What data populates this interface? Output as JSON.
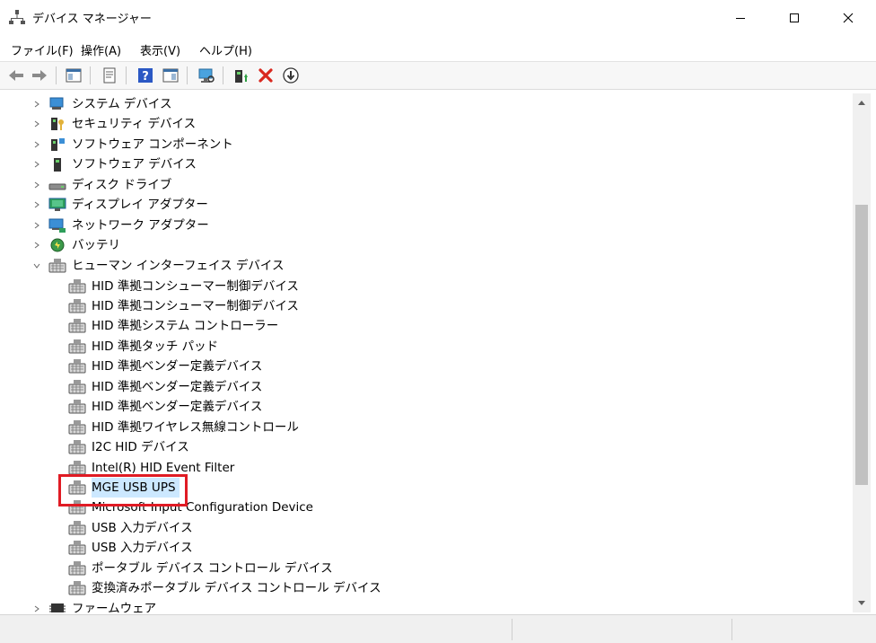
{
  "window": {
    "title": "デバイス マネージャー"
  },
  "menu": {
    "items": [
      "ファイル(F)",
      "操作(A)",
      "表示(V)",
      "ヘルプ(H)"
    ]
  },
  "tree": {
    "categories_top": [
      {
        "label": "システム デバイス",
        "icon": "system-devices-icon"
      },
      {
        "label": "セキュリティ デバイス",
        "icon": "security-devices-icon"
      },
      {
        "label": "ソフトウェア コンポーネント",
        "icon": "software-components-icon"
      },
      {
        "label": "ソフトウェア デバイス",
        "icon": "software-devices-icon"
      },
      {
        "label": "ディスク ドライブ",
        "icon": "disk-drive-icon"
      },
      {
        "label": "ディスプレイ アダプター",
        "icon": "display-adapter-icon"
      },
      {
        "label": "ネットワーク アダプター",
        "icon": "network-adapter-icon"
      },
      {
        "label": "バッテリ",
        "icon": "battery-icon"
      }
    ],
    "hid": {
      "label": "ヒューマン インターフェイス デバイス",
      "children": [
        "HID 準拠コンシューマー制御デバイス",
        "HID 準拠コンシューマー制御デバイス",
        "HID 準拠システム コントローラー",
        "HID 準拠タッチ パッド",
        "HID 準拠ベンダー定義デバイス",
        "HID 準拠ベンダー定義デバイス",
        "HID 準拠ベンダー定義デバイス",
        "HID 準拠ワイヤレス無線コントロール",
        "I2C HID デバイス",
        "Intel(R) HID Event Filter",
        "MGE USB UPS",
        "Microsoft Input Configuration Device",
        "USB 入力デバイス",
        "USB 入力デバイス",
        "ポータブル デバイス コントロール デバイス",
        "変換済みポータブル デバイス コントロール デバイス"
      ],
      "selected_index": 10
    },
    "category_bottom": {
      "label": "ファームウェア",
      "icon": "firmware-icon"
    }
  },
  "colors": {
    "selection": "#cce8ff",
    "highlight": "#e01b24"
  }
}
